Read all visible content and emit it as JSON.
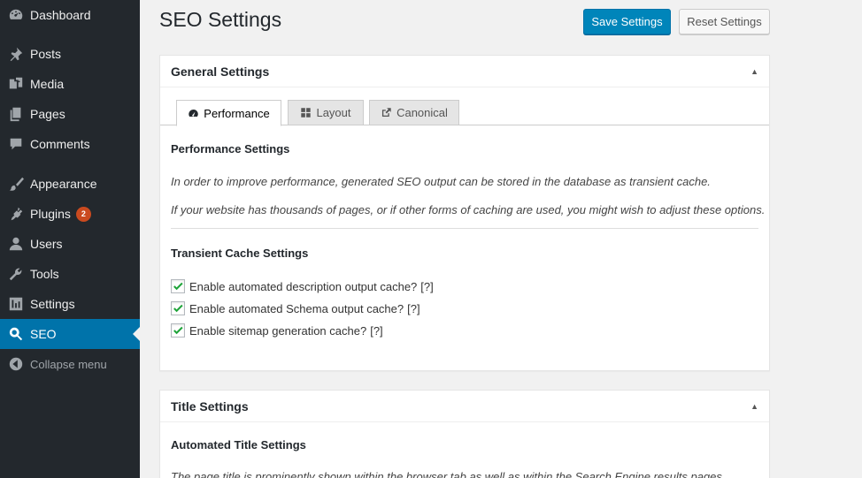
{
  "sidebar": {
    "items": [
      {
        "label": "Dashboard",
        "icon": "dashboard-icon"
      },
      {
        "label": "Posts",
        "icon": "pin-icon"
      },
      {
        "label": "Media",
        "icon": "media-icon"
      },
      {
        "label": "Pages",
        "icon": "pages-icon"
      },
      {
        "label": "Comments",
        "icon": "comment-icon"
      },
      {
        "label": "Appearance",
        "icon": "brush-icon"
      },
      {
        "label": "Plugins",
        "icon": "plugin-icon",
        "badge": "2"
      },
      {
        "label": "Users",
        "icon": "user-icon"
      },
      {
        "label": "Tools",
        "icon": "wrench-icon"
      },
      {
        "label": "Settings",
        "icon": "settings-icon"
      },
      {
        "label": "SEO",
        "icon": "search-icon",
        "active": true
      },
      {
        "label": "Collapse menu",
        "icon": "collapse-icon"
      }
    ]
  },
  "header": {
    "title": "SEO Settings",
    "save_label": "Save Settings",
    "reset_label": "Reset Settings"
  },
  "general": {
    "title": "General Settings",
    "tabs": [
      {
        "label": "Performance",
        "icon": "gauge-icon",
        "active": true
      },
      {
        "label": "Layout",
        "icon": "grid-icon"
      },
      {
        "label": "Canonical",
        "icon": "external-link-icon"
      }
    ],
    "performance_heading": "Performance Settings",
    "desc1": "In order to improve performance, generated SEO output can be stored in the database as transient cache.",
    "desc2": "If your website has thousands of pages, or if other forms of caching are used, you might wish to adjust these options.",
    "transient_heading": "Transient Cache Settings",
    "checkboxes": [
      {
        "label": "Enable automated description output cache?",
        "help": "[?]",
        "checked": true
      },
      {
        "label": "Enable automated Schema output cache?",
        "help": "[?]",
        "checked": true
      },
      {
        "label": "Enable sitemap generation cache?",
        "help": "[?]",
        "checked": true
      }
    ]
  },
  "title_settings": {
    "title": "Title Settings",
    "heading": "Automated Title Settings",
    "desc": "The page title is prominently shown within the browser tab as well as within the Search Engine results pages."
  },
  "colors": {
    "sidebar_bg": "#23282d",
    "active_bg": "#0073aa",
    "primary_button": "#0085ba",
    "badge": "#ca4a1f",
    "check": "#1da338"
  }
}
